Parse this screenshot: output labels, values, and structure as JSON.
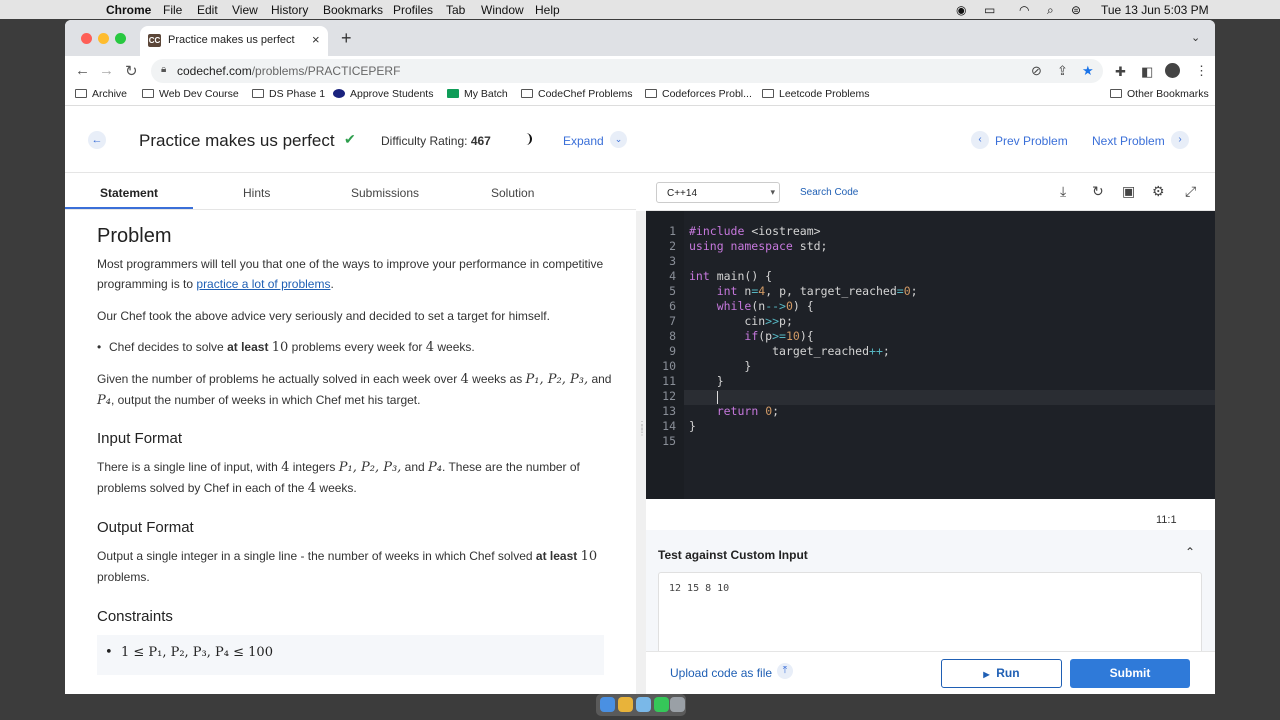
{
  "menubar": {
    "apple": "",
    "app": "Chrome",
    "items": [
      "File",
      "Edit",
      "View",
      "History",
      "Bookmarks",
      "Profiles",
      "Tab",
      "Window",
      "Help"
    ],
    "clock": "Tue 13 Jun  5:03 PM"
  },
  "browser": {
    "tab_title": "Practice makes us perfect - Pr",
    "favicon_text": "CC",
    "url_host": "codechef.com",
    "url_path": "/problems/PRACTICEPERF",
    "bookmarks": [
      "Archive",
      "Web Dev Course",
      "DS Phase 1",
      "Approve Students",
      "My Batch",
      "CodeChef Problems",
      "Codeforces Probl...",
      "Leetcode Problems"
    ],
    "other_bookmarks": "Other Bookmarks"
  },
  "header": {
    "title": "Practice makes us perfect",
    "difficulty_label": "Difficulty Rating:",
    "difficulty_value": "467",
    "expand": "Expand",
    "prev": "Prev Problem",
    "next": "Next Problem"
  },
  "left_tabs": [
    "Statement",
    "Hints",
    "Submissions",
    "Solution"
  ],
  "statement": {
    "heading": "Problem",
    "p1a": "Most programmers will tell you that one of the ways to improve your performance in competitive",
    "p1b": "programming is to",
    "p1_link": "practice a lot of problems",
    "p1c": ".",
    "p2": "Our Chef took the above advice very seriously and decided to set a target for himself.",
    "bullet_a": "Chef decides to solve",
    "bullet_bold": "at least",
    "bullet_n": "10",
    "bullet_b": "problems every week for",
    "bullet_n2": "4",
    "bullet_c": "weeks.",
    "p3a": "Given the number of problems he actually solved in each week over",
    "p3_n": "4",
    "p3b": "weeks as",
    "p3_vars": "P₁, P₂, P₃,",
    "p3c": "and",
    "p3_var4": "P₄",
    "p3d": ", output the number of weeks in which Chef met his target.",
    "input_heading": "Input Format",
    "in_a": "There is a single line of input, with",
    "in_n": "4",
    "in_b": "integers",
    "in_vars": "P₁, P₂, P₃,",
    "in_c": "and",
    "in_var4": "P₄",
    "in_d": ". These are the number of",
    "in_e": "problems solved by Chef in each of the",
    "in_n2": "4",
    "in_f": "weeks.",
    "output_heading": "Output Format",
    "out_a": "Output a single integer in a single line - the number of weeks in which Chef solved",
    "out_bold": "at least",
    "out_n": "10",
    "out_b": "problems.",
    "constraints_heading": "Constraints",
    "constraint": "1 ≤ P₁, P₂, P₃, P₄ ≤ 100"
  },
  "editor": {
    "language": "C++14",
    "search_code": "Search Code",
    "cursor_pos": "11:1",
    "lines": [
      "1",
      "2",
      "3",
      "4",
      "5",
      "6",
      "7",
      "8",
      "9",
      "10",
      "11",
      "12",
      "13",
      "14",
      "15"
    ]
  },
  "custom_input": {
    "title": "Test against Custom Input",
    "value": "12 15 8 10"
  },
  "footer": {
    "upload": "Upload code as file",
    "run": "Run",
    "submit": "Submit"
  }
}
